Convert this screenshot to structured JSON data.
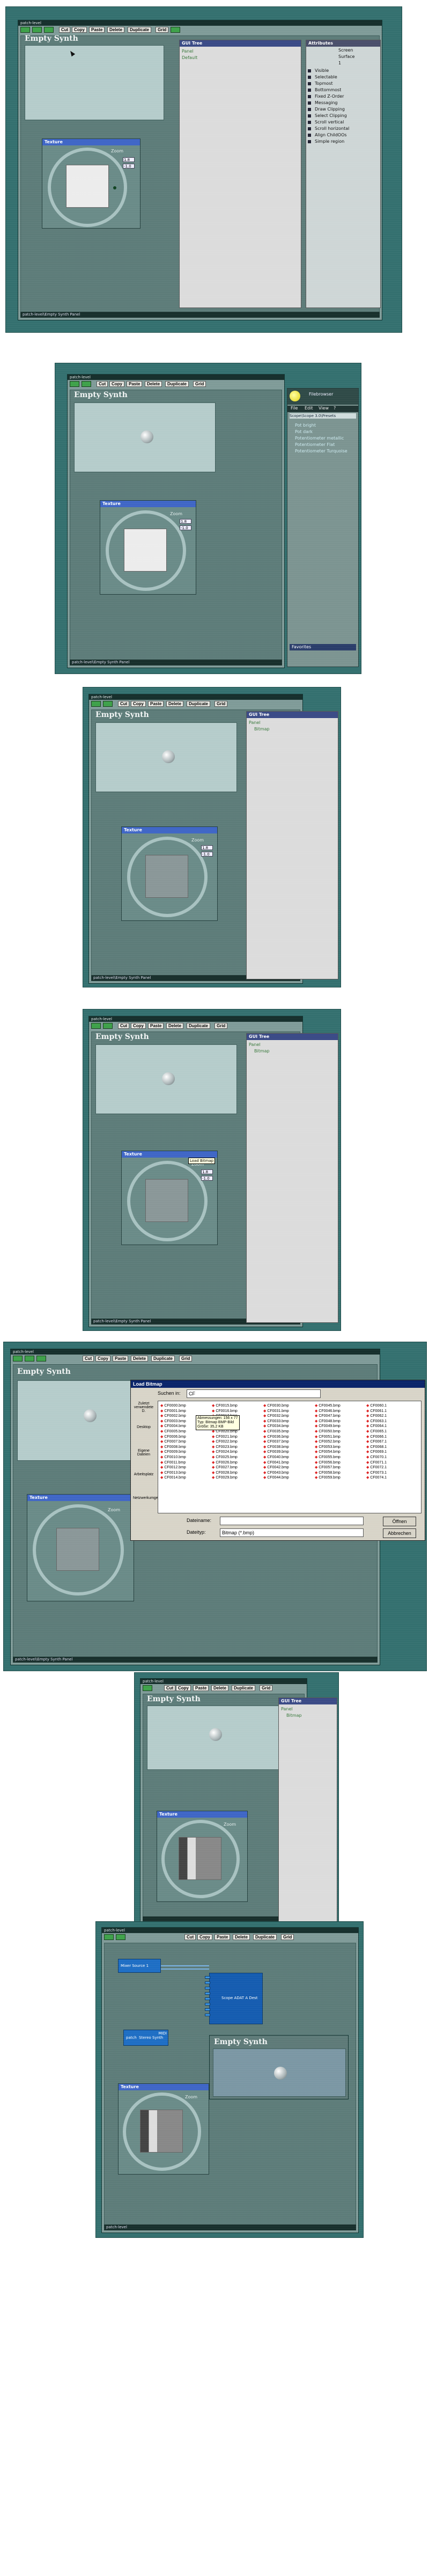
{
  "common": {
    "app_title": "patch-level",
    "toolbar": [
      "Cut",
      "Copy",
      "Paste",
      "Delete",
      "Duplicate",
      "Grid"
    ],
    "panel_title": "Empty Synth",
    "texture_title": "Texture",
    "zoom_label": "Zoom",
    "zoom_values": [
      "1.8",
      "-1.0"
    ],
    "status": "patch-level\\Empty Synth Panel",
    "logo": "scope"
  },
  "shot1": {
    "list_header": "GUI Tree",
    "list_items": [
      "Panel",
      "Default"
    ],
    "attr_header": "Attributes",
    "attr_values": [
      "Screen",
      "Surface",
      "1"
    ],
    "attr_items": [
      "Visible",
      "Selectable",
      "Topmost",
      "Bottommost",
      "Fixed Z-Order",
      "Messaging",
      "Draw Clipping",
      "Select Clipping",
      "Scroll vertical",
      "Scroll horizontal",
      "Align ChildOOs",
      "Simple region"
    ]
  },
  "shot2": {
    "browser_title": "Filebrowser",
    "browser_menu": [
      "File",
      "Edit",
      "View",
      "?"
    ],
    "browser_path": "Scope\\Scope 3.0\\Presets",
    "browser_items": [
      "Pot bright",
      "Pot dark",
      "Potentiometer metallic",
      "Potentiometer Flat",
      "Potentiometer Turquoise"
    ],
    "browser_footer": "Favorites"
  },
  "shot3": {
    "list_header": "GUI Tree",
    "list_items": [
      "Panel",
      "Bitmap"
    ]
  },
  "shot4": {
    "list_header": "GUI Tree",
    "list_items": [
      "Panel",
      "Bitmap"
    ],
    "tooltip": "Load Bitmap"
  },
  "shot5": {
    "dialog_title": "Load Bitmap",
    "search_label": "Suchen in:",
    "search_value": "CF",
    "places": [
      "Zuletzt verwendete D.",
      "Desktop",
      "Eigene Dateien",
      "Arbeitsplatz",
      "Netzwerkumgebung"
    ],
    "tooltip_lines": [
      "Abmessungen: 156 x 77",
      "Typ: Bitmap BMP-Bild",
      "Größe: 35,2 KB"
    ],
    "file_cols": [
      [
        "CF0000.bmp",
        "CF0001.bmp",
        "CF0002.bmp",
        "CF0003.bmp",
        "CF0004.bmp",
        "CF0005.bmp",
        "CF0006.bmp",
        "CF0007.bmp",
        "CF0008.bmp",
        "CF0009.bmp",
        "CF0010.bmp",
        "CF0011.bmp",
        "CF0012.bmp",
        "CF0013.bmp",
        "CF0014.bmp"
      ],
      [
        "CF0015.bmp",
        "CF0016.bmp",
        "CF0017.bmp",
        "CF0018.bmp",
        "CF0019.bmp",
        "CF0020.bmp",
        "CF0021.bmp",
        "CF0022.bmp",
        "CF0023.bmp",
        "CF0024.bmp",
        "CF0025.bmp",
        "CF0026.bmp",
        "CF0027.bmp",
        "CF0028.bmp",
        "CF0029.bmp"
      ],
      [
        "CF0030.bmp",
        "CF0031.bmp",
        "CF0032.bmp",
        "CF0033.bmp",
        "CF0034.bmp",
        "CF0035.bmp",
        "CF0036.bmp",
        "CF0037.bmp",
        "CF0038.bmp",
        "CF0039.bmp",
        "CF0040.bmp",
        "CF0041.bmp",
        "CF0042.bmp",
        "CF0043.bmp",
        "CF0044.bmp"
      ],
      [
        "CF0045.bmp",
        "CF0046.bmp",
        "CF0047.bmp",
        "CF0048.bmp",
        "CF0049.bmp",
        "CF0050.bmp",
        "CF0051.bmp",
        "CF0052.bmp",
        "CF0053.bmp",
        "CF0054.bmp",
        "CF0055.bmp",
        "CF0056.bmp",
        "CF0057.bmp",
        "CF0058.bmp",
        "CF0059.bmp"
      ],
      [
        "CF0060.1",
        "CF0061.1",
        "CF0062.1",
        "CF0063.1",
        "CF0064.1",
        "CF0065.1",
        "CF0066.1",
        "CF0067.1",
        "CF0068.1",
        "CF0069.1",
        "CF0070.1",
        "CF0071.1",
        "CF0072.1",
        "CF0073.1",
        "CF0074.1"
      ]
    ],
    "filename_label": "Dateiname:",
    "filetype_label": "Dateityp:",
    "filetype_value": "Bitmap (*.bmp)",
    "open_button": "Öffnen",
    "cancel_button": "Abbrechen"
  },
  "shot6": {
    "list_header": "GUI Tree",
    "list_items": [
      "Panel",
      "Bitmap"
    ]
  },
  "shot7": {
    "module_a": "Mixer Source 1",
    "module_b": "Scope ADAT A Dest",
    "module_c": "Stereo Synth",
    "module_c_label": "patch",
    "module_c_port": "MIDI"
  }
}
